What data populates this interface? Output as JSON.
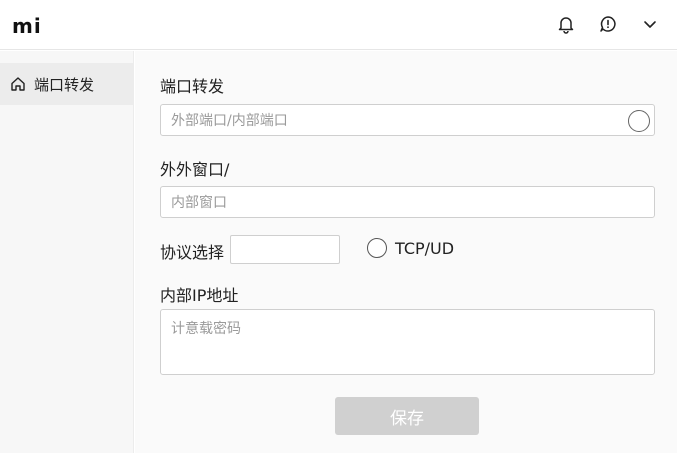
{
  "header": {
    "logo": "mi",
    "icons": [
      "bell-icon",
      "notification-alert-icon",
      "chevron-down-icon"
    ]
  },
  "sidebar": {
    "items": [
      {
        "label": "端口转发",
        "icon": "home-icon",
        "active": true
      }
    ]
  },
  "form": {
    "port_forward": {
      "title": "端口转发",
      "placeholder": "外部端口/内部端口"
    },
    "outer_window": {
      "title": "外外窗口/",
      "placeholder": "内部窗口"
    },
    "protocol": {
      "title": "协议选择",
      "option_label": "TCP/UD"
    },
    "internal_ip": {
      "title": "内部IP地址",
      "placeholder": "计意载密码"
    },
    "save_label": "保存"
  },
  "colors": {
    "save_button_bg": "#d0d0d0",
    "sidebar_active_bg": "#ececec"
  }
}
